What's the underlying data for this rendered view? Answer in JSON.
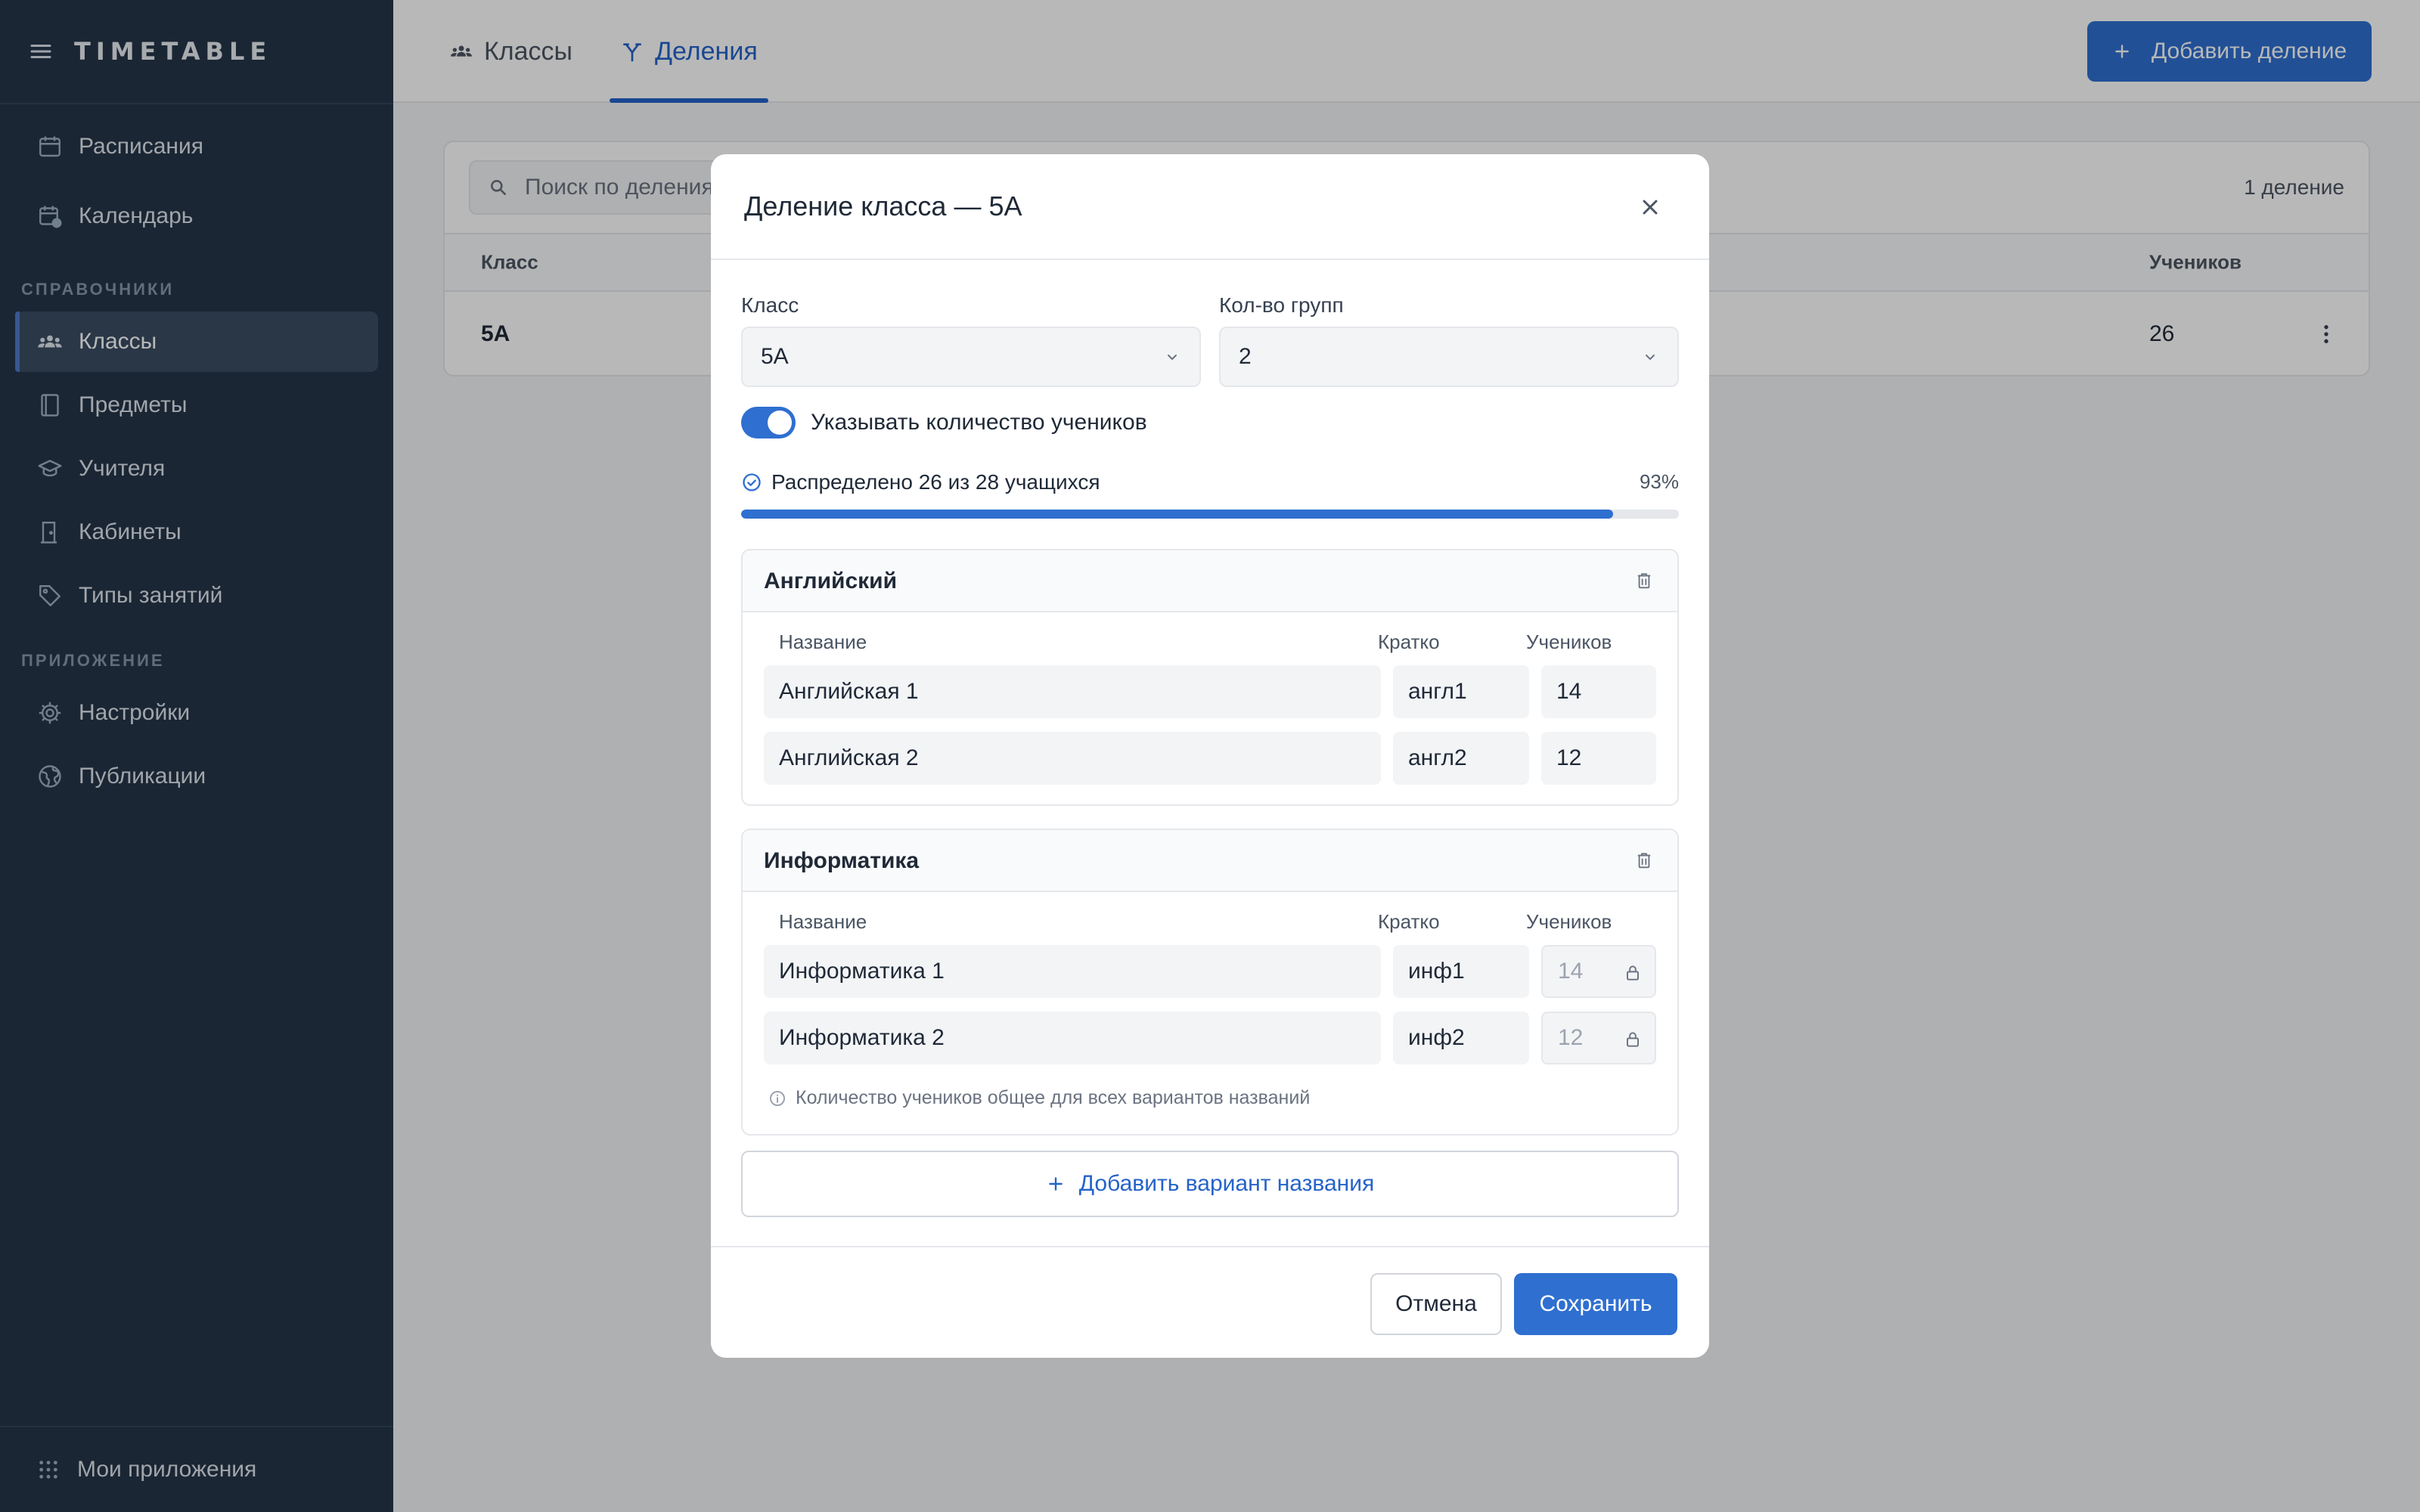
{
  "sidebar": {
    "brand": "TIMETABLE",
    "items_top": [
      {
        "label": "Расписания",
        "icon": "calendar-icon"
      },
      {
        "label": "Календарь",
        "icon": "calendar-clock-icon"
      }
    ],
    "section_refs": "СПРАВОЧНИКИ",
    "items_refs": [
      {
        "label": "Классы",
        "icon": "users-icon",
        "active": true
      },
      {
        "label": "Предметы",
        "icon": "book-icon"
      },
      {
        "label": "Учителя",
        "icon": "graduation-cap-icon"
      },
      {
        "label": "Кабинеты",
        "icon": "door-icon"
      },
      {
        "label": "Типы занятий",
        "icon": "tag-icon"
      }
    ],
    "section_app": "ПРИЛОЖЕНИЕ",
    "items_app": [
      {
        "label": "Настройки",
        "icon": "gear-icon"
      },
      {
        "label": "Публикации",
        "icon": "globe-icon"
      }
    ],
    "bottom_label": "Мои приложения"
  },
  "header": {
    "tabs": [
      {
        "label": "Классы",
        "icon": "users-icon"
      },
      {
        "label": "Деления",
        "icon": "split-icon",
        "active": true
      }
    ],
    "add_button": "Добавить деление"
  },
  "list": {
    "search_placeholder": "Поиск по делениям",
    "count": "1 деление",
    "columns": {
      "class": "Класс",
      "students": "Учеников"
    },
    "rows": [
      {
        "class": "5А",
        "students": "26"
      }
    ]
  },
  "modal": {
    "title": "Деление класса — 5А",
    "class_label": "Класс",
    "class_value": "5А",
    "groups_label": "Кол-во групп",
    "groups_value": "2",
    "toggle_label": "Указывать количество учеников",
    "toggle_on": true,
    "distributed_text": "Распределено 26 из 28 учащихся",
    "distributed_percent_label": "93%",
    "distributed_fraction": 0.93,
    "column_name": "Название",
    "column_short": "Кратко",
    "column_students": "Учеников",
    "groups": [
      {
        "title": "Английский",
        "rows": [
          {
            "name": "Английская 1",
            "short": "англ1",
            "students": "14"
          },
          {
            "name": "Английская 2",
            "short": "англ2",
            "students": "12"
          }
        ]
      },
      {
        "title": "Информатика",
        "rows": [
          {
            "name": "Информатика 1",
            "short": "инф1",
            "students": "14"
          },
          {
            "name": "Информатика 2",
            "short": "инф2",
            "students": "12"
          }
        ],
        "note": "Количество учеников общее для всех вариантов названий"
      }
    ],
    "add_variant": "Добавить вариант названия",
    "cancel": "Отмена",
    "save": "Сохранить"
  },
  "colors": {
    "sidebar_bg": "#243548",
    "accent": "#2f6fd0",
    "overlay": "rgba(0,0,0,0.28)"
  }
}
